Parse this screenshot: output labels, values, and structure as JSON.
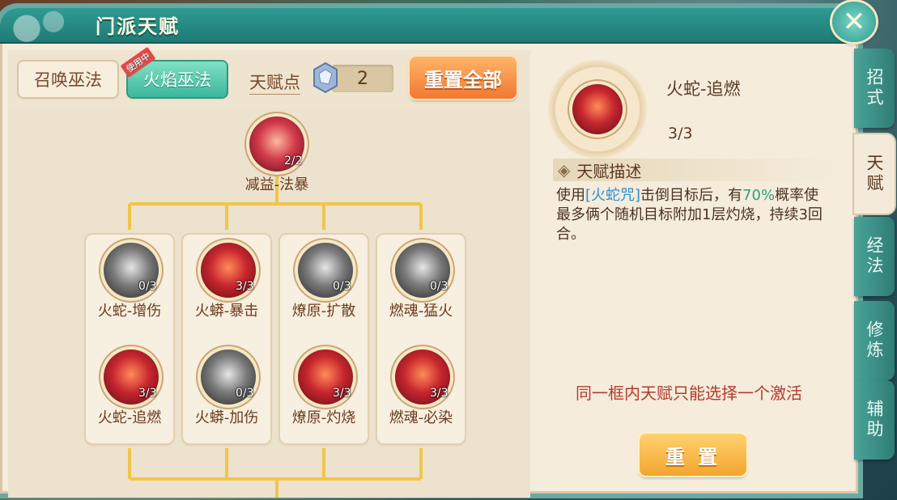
{
  "window": {
    "title": "门派天赋",
    "close_symbol": "✕"
  },
  "school_tabs": [
    {
      "label": "召唤巫法",
      "active": false
    },
    {
      "label": "火焰巫法",
      "active": true,
      "badge": "使用中"
    }
  ],
  "talent_points": {
    "label": "天赋点",
    "value": "2"
  },
  "reset_all_label": "重置全部",
  "tree": {
    "root": {
      "name": "减益-法暴",
      "count": "2/2"
    },
    "columns": [
      {
        "nodes": [
          {
            "name": "火蛇-增伤",
            "count": "0/3",
            "active": false
          },
          {
            "name": "火蛇-追燃",
            "count": "3/3",
            "active": true
          }
        ]
      },
      {
        "nodes": [
          {
            "name": "火蟒-暴击",
            "count": "3/3",
            "active": true
          },
          {
            "name": "火蟒-加伤",
            "count": "0/3",
            "active": false
          }
        ]
      },
      {
        "nodes": [
          {
            "name": "燎原-扩散",
            "count": "0/3",
            "active": false
          },
          {
            "name": "燎原-灼烧",
            "count": "3/3",
            "active": true
          }
        ]
      },
      {
        "nodes": [
          {
            "name": "燃魂-猛火",
            "count": "0/3",
            "active": false
          },
          {
            "name": "燃魂-必染",
            "count": "3/3",
            "active": true
          }
        ]
      }
    ]
  },
  "detail": {
    "name": "火蛇-追燃",
    "count": "3/3",
    "section_title": "天赋描述",
    "desc_parts": {
      "p1": "使用",
      "skill": "[火蛇咒]",
      "p2": "击倒目标后，有",
      "chance": "70%",
      "p3": "概率使最多俩个随机目标附加1层灼烧，持续3回合。"
    },
    "rule_note": "同一框内天赋只能选择一个激活",
    "reset_label": "重 置"
  },
  "side_tabs": [
    {
      "label": "招式",
      "active": false
    },
    {
      "label": "天赋",
      "active": true
    },
    {
      "label": "经法",
      "active": false
    },
    {
      "label": "修炼",
      "active": false
    },
    {
      "label": "辅助",
      "active": false
    }
  ],
  "colors": {
    "accent": "#2f9b94",
    "gold_line": "#f0c64a",
    "reset_orange": "#f0792f"
  }
}
